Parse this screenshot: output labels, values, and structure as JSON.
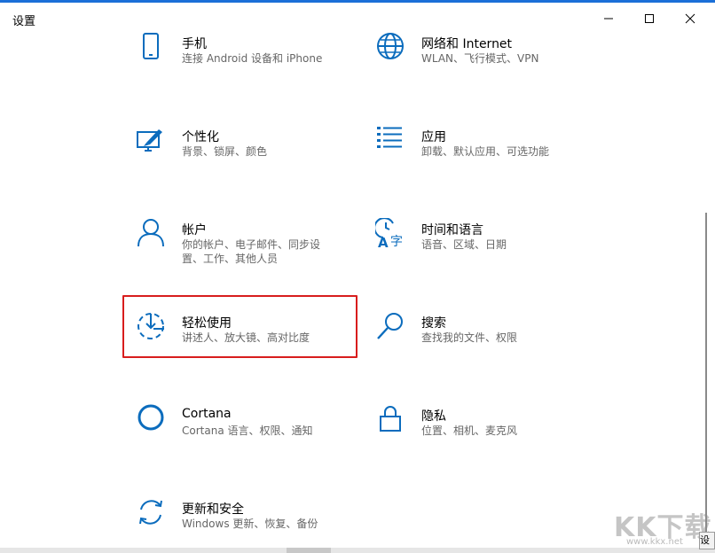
{
  "window": {
    "title": "设置",
    "controls": {
      "minimize_icon": "minimize-icon",
      "maximize_icon": "maximize-icon",
      "close_icon": "close-icon"
    }
  },
  "accent_color": "#0b6cbd",
  "highlight_color": "#d81d1d",
  "tiles": [
    {
      "label": "手机",
      "desc": "连接 Android 设备和 iPhone",
      "icon": "phone-icon"
    },
    {
      "label": "网络和 Internet",
      "desc": "WLAN、飞行模式、VPN",
      "icon": "globe-icon"
    },
    {
      "label": "个性化",
      "desc": "背景、锁屏、颜色",
      "icon": "personalization-icon"
    },
    {
      "label": "应用",
      "desc": "卸载、默认应用、可选功能",
      "icon": "apps-list-icon"
    },
    {
      "label": "帐户",
      "desc": "你的帐户、电子邮件、同步设置、工作、其他人员",
      "icon": "person-icon"
    },
    {
      "label": "时间和语言",
      "desc": "语音、区域、日期",
      "icon": "time-language-icon"
    },
    {
      "label": "轻松使用",
      "desc": "讲述人、放大镜、高对比度",
      "icon": "ease-of-access-icon"
    },
    {
      "label": "搜索",
      "desc": "查找我的文件、权限",
      "icon": "search-icon"
    },
    {
      "label": "Cortana",
      "desc": "Cortana 语言、权限、通知",
      "icon": "cortana-icon"
    },
    {
      "label": "隐私",
      "desc": "位置、相机、麦克风",
      "icon": "lock-icon"
    },
    {
      "label": "更新和安全",
      "desc": "Windows 更新、恢复、备份",
      "icon": "sync-icon"
    }
  ],
  "watermark": {
    "text": "KK下载",
    "sub": "www.kkx.net"
  },
  "mini_tab": {
    "text": "设"
  }
}
